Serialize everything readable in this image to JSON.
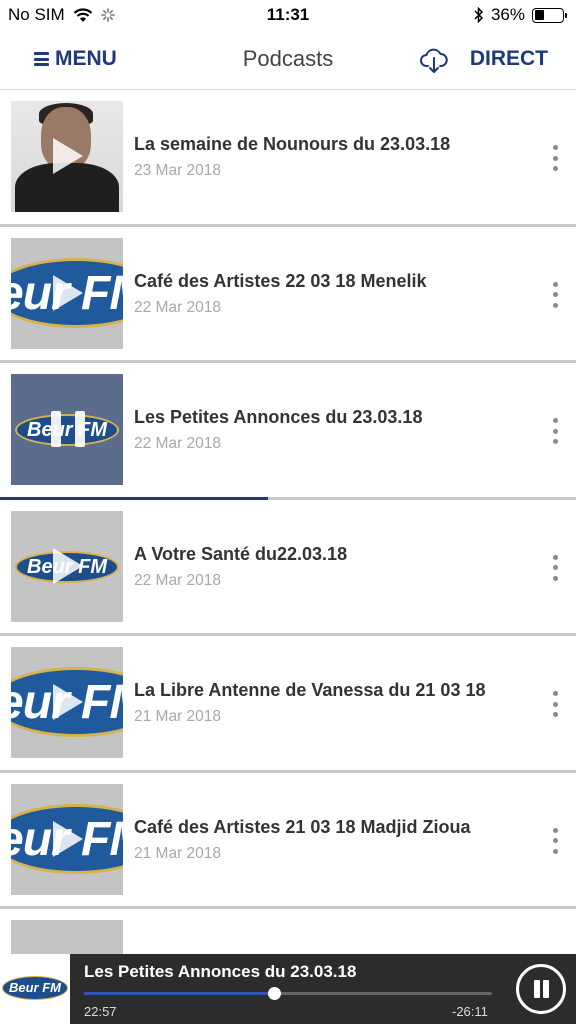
{
  "status_bar": {
    "carrier": "No SIM",
    "time": "11:31",
    "battery_percent": "36%",
    "battery_level": 0.36
  },
  "header": {
    "menu_label": "MENU",
    "title": "Podcasts",
    "direct_label": "DIRECT"
  },
  "items": [
    {
      "title": "La semaine de Nounours du 23.03.18",
      "date": "23 Mar 2018",
      "state": "play",
      "thumb": "photo"
    },
    {
      "title": "Café des Artistes  22 03 18 Menelik",
      "date": "22 Mar 2018",
      "state": "play",
      "thumb": "logo-large"
    },
    {
      "title": "Les Petites Annonces du 23.03.18",
      "date": "22 Mar 2018",
      "state": "pause",
      "thumb": "logo-small",
      "progress": 0.465
    },
    {
      "title": "A Votre Santé du22.03.18",
      "date": "22 Mar 2018",
      "state": "play",
      "thumb": "logo-small"
    },
    {
      "title": "La Libre Antenne de Vanessa du 21 03 18",
      "date": "21 Mar 2018",
      "state": "play",
      "thumb": "logo-large"
    },
    {
      "title": "Café des Artistes  21 03 18 Madjid Zioua",
      "date": "21 Mar 2018",
      "state": "play",
      "thumb": "logo-large"
    }
  ],
  "logo": {
    "small_text": "Beur FM",
    "large_text": "eur FM",
    "player_text": "Beur FM"
  },
  "player": {
    "title": "Les Petites Annonces du 23.03.18",
    "elapsed": "22:57",
    "remaining": "-26:11",
    "progress": 0.465
  }
}
